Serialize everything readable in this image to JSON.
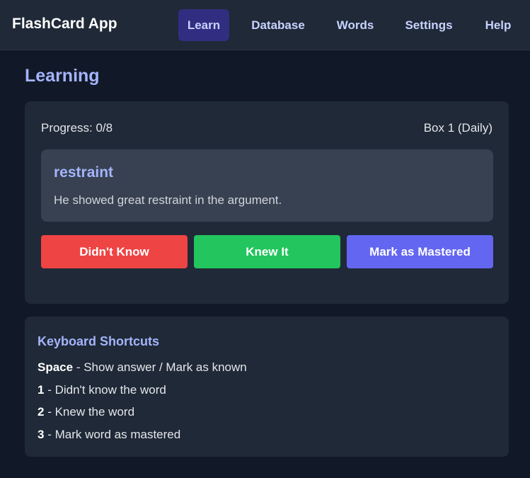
{
  "app": {
    "title": "FlashCard App"
  },
  "nav": {
    "items": [
      {
        "label": "Learn",
        "active": true
      },
      {
        "label": "Database",
        "active": false
      },
      {
        "label": "Words",
        "active": false
      },
      {
        "label": "Settings",
        "active": false
      },
      {
        "label": "Help",
        "active": false
      }
    ]
  },
  "page": {
    "title": "Learning"
  },
  "card": {
    "progress": "Progress: 0/8",
    "box": "Box 1 (Daily)",
    "word": "restraint",
    "sentence": "He showed great restraint in the argument.",
    "buttons": {
      "didnt_know": "Didn't Know",
      "knew_it": "Knew It",
      "mastered": "Mark as Mastered"
    }
  },
  "shortcuts": {
    "title": "Keyboard Shortcuts",
    "items": [
      {
        "key": "Space",
        "desc": " - Show answer / Mark as known"
      },
      {
        "key": "1",
        "desc": " - Didn't know the word"
      },
      {
        "key": "2",
        "desc": " - Knew the word"
      },
      {
        "key": "3",
        "desc": " - Mark word as mastered"
      }
    ]
  },
  "colors": {
    "background": "#111827",
    "surface": "#1f2937",
    "accent": "#a5b4fc",
    "danger": "#ef4444",
    "success": "#22c55e",
    "primary": "#6366f1"
  }
}
